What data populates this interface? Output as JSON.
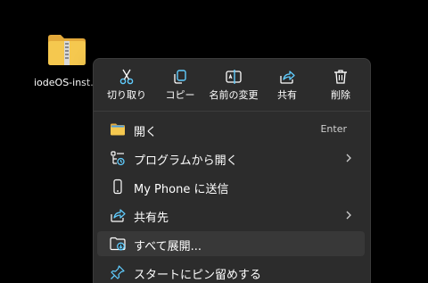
{
  "desktop": {
    "icon_label": "iodeOS-inst...",
    "icon_name": "zip-folder-icon"
  },
  "context_menu": {
    "quick_actions": [
      {
        "label": "切り取り",
        "icon": "scissors-icon"
      },
      {
        "label": "コピー",
        "icon": "copy-icon"
      },
      {
        "label": "名前の変更",
        "icon": "rename-icon"
      },
      {
        "label": "共有",
        "icon": "share-icon"
      },
      {
        "label": "削除",
        "icon": "trash-icon"
      }
    ],
    "items": [
      {
        "label": "開く",
        "shortcut": "Enter",
        "icon": "folder-icon"
      },
      {
        "label": "プログラムから開く",
        "icon": "open-with-icon",
        "submenu": true
      },
      {
        "label": "My Phone に送信",
        "icon": "phone-icon"
      },
      {
        "label": "共有先",
        "icon": "share-icon",
        "submenu": true
      },
      {
        "label": "すべて展開...",
        "icon": "extract-icon",
        "highlighted": true
      },
      {
        "label": "スタートにピン留めする",
        "icon": "pin-icon"
      }
    ]
  },
  "colors": {
    "desktop_bg": "#000000",
    "menu_bg": "#2c2c2c",
    "menu_border": "#3b3b3b",
    "hover_bg": "#383838",
    "accent": "#60cdff",
    "folder_yellow": "#f0c14b"
  }
}
